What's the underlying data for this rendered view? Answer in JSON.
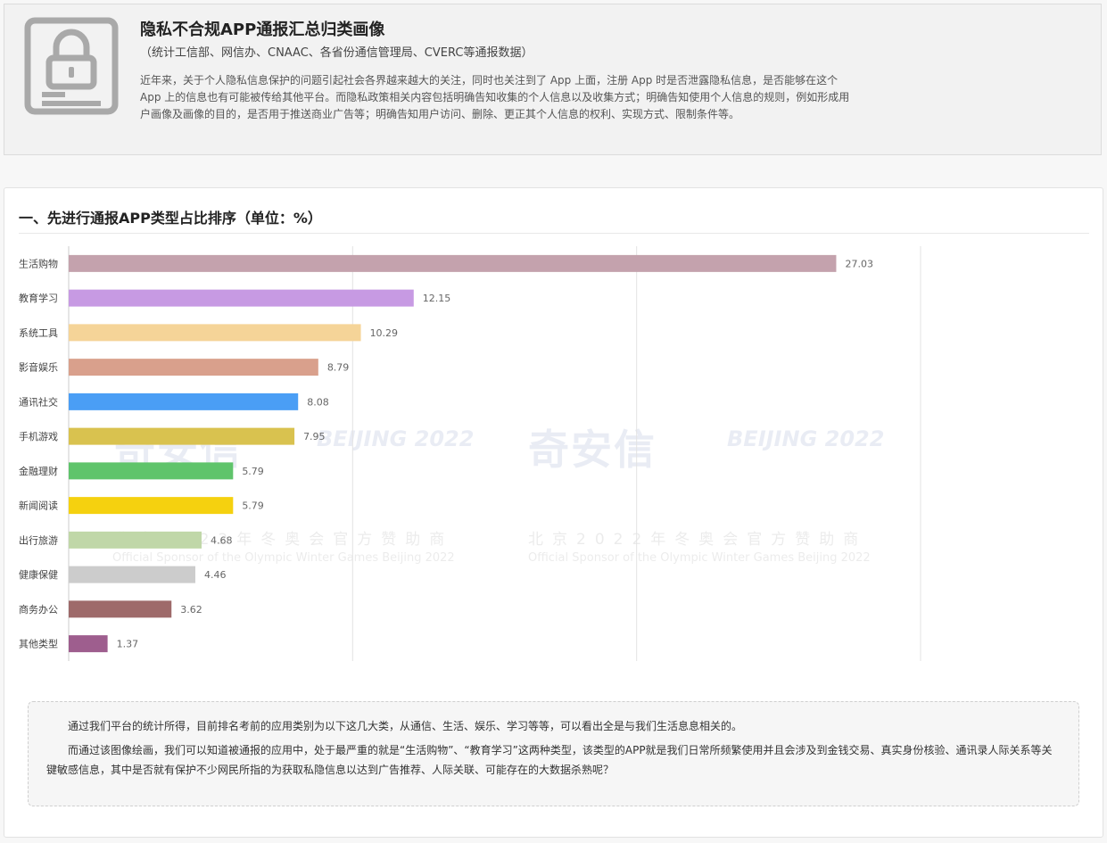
{
  "header": {
    "title": "隐私不合规APP通报汇总归类画像",
    "subtitle": "（统计工信部、网信办、CNAAC、各省份通信管理局、CVERC等通报数据）",
    "description": "近年来，关于个人隐私信息保护的问题引起社会各界越来越大的关注，同时也关注到了 App 上面，注册 App 时是否泄露隐私信息，是否能够在这个 App 上的信息也有可能被传给其他平台。而隐私政策相关内容包括明确告知收集的个人信息以及收集方式；明确告知使用个人信息的规则，例如形成用户画像及画像的目的，是否用于推送商业广告等；明确告知用户访问、删除、更正其个人信息的权利、实现方式、限制条件等。",
    "icon": "lock-icon"
  },
  "section": {
    "title": "一、先进行通报APP类型占比排序（单位：%）"
  },
  "watermark": {
    "company": "奇安信",
    "beijing": "BEIJING 2022",
    "sponsor_cn": "北京2022年冬奥会官方赞助商",
    "sponsor_en": "Official Sponsor of the Olympic Winter Games Beijing 2022"
  },
  "chart_data": {
    "type": "bar",
    "orientation": "horizontal",
    "categories": [
      "生活购物",
      "教育学习",
      "系统工具",
      "影音娱乐",
      "通讯社交",
      "手机游戏",
      "金融理财",
      "新闻阅读",
      "出行旅游",
      "健康保健",
      "商务办公",
      "其他类型"
    ],
    "values": [
      27.03,
      12.15,
      10.29,
      8.79,
      8.08,
      7.95,
      5.79,
      5.79,
      4.68,
      4.46,
      3.62,
      1.37
    ],
    "value_labels": [
      "27.03",
      "12.15",
      "10.29",
      "8.79",
      "8.08",
      "7.95",
      "5.79",
      "5.79",
      "4.68",
      "4.46",
      "3.62",
      "1.37"
    ],
    "colors": [
      "#c4a2ad",
      "#c79ae3",
      "#f5d498",
      "#d9a08c",
      "#4a9ef5",
      "#d9c24f",
      "#5fc46b",
      "#f5d10f",
      "#c0d7a8",
      "#cccccc",
      "#9e6a6a",
      "#9e5e8e"
    ],
    "xlim": [
      0,
      30
    ],
    "grid": true,
    "title": "",
    "xlabel": "",
    "ylabel": ""
  },
  "summary": {
    "para1": "通过我们平台的统计所得，目前排名考前的应用类别为以下这几大类，从通信、生活、娱乐、学习等等，可以看出全是与我们生活息息相关的。",
    "para2": "而通过该图像绘画，我们可以知道被通报的应用中，处于最严重的就是“生活购物”、“教育学习”这两种类型，该类型的APP就是我们日常所频繁使用并且会涉及到金钱交易、真实身份核验、通讯录人际关系等关键敏感信息，其中是否就有保护不少网民所指的为获取私隐信息以达到广告推荐、人际关联、可能存在的大数据杀熟呢？"
  }
}
